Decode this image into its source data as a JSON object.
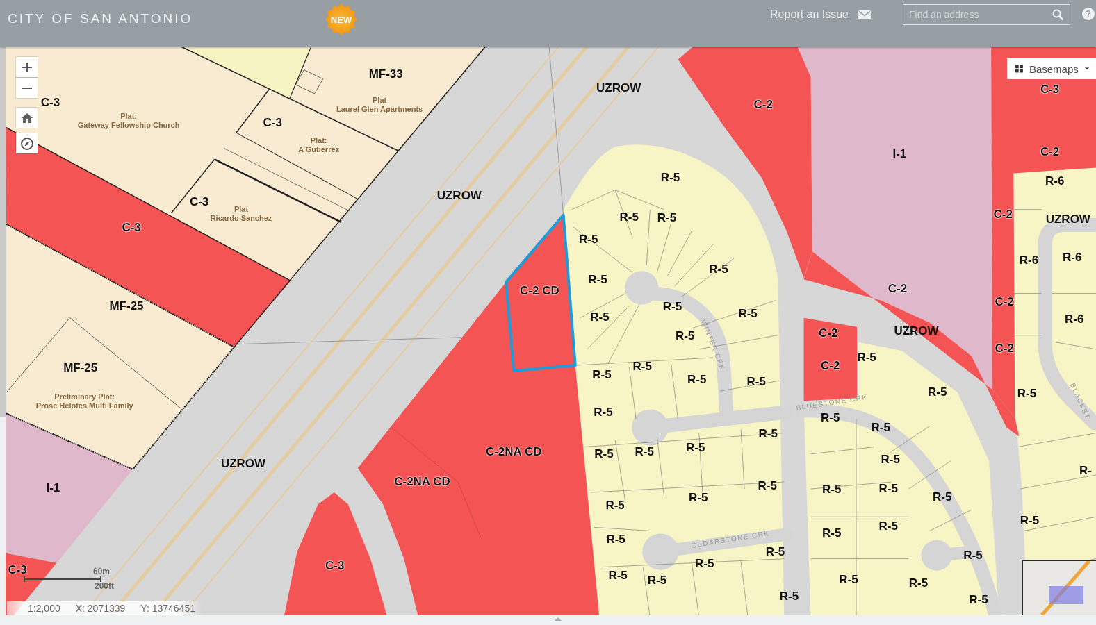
{
  "header": {
    "title": "CITY OF SAN ANTONIO",
    "badge": "NEW",
    "report_link": "Report an Issue",
    "search": {
      "placeholder": "Find an address"
    },
    "help": "?"
  },
  "map": {
    "basemaps_button": "Basemaps",
    "labels": [
      {
        "kind": "zone",
        "text": "MF-33"
      },
      {
        "kind": "zone",
        "text": "UZROW"
      },
      {
        "kind": "zone",
        "text": "C-3"
      },
      {
        "kind": "zone",
        "text": "C-3"
      },
      {
        "kind": "plat",
        "text": "Plat\nLaurel Glen Apartments"
      },
      {
        "kind": "zone",
        "text": "C-2"
      },
      {
        "kind": "plat",
        "text": "Plat:\nGateway Fellowship Church"
      },
      {
        "kind": "zone",
        "text": "C-3"
      },
      {
        "kind": "plat",
        "text": "Plat:\nA Gutierrez"
      },
      {
        "kind": "zone",
        "text": "I-1"
      },
      {
        "kind": "zone",
        "text": "C-2"
      },
      {
        "kind": "zone",
        "text": "R-5"
      },
      {
        "kind": "zone",
        "text": "R-6"
      },
      {
        "kind": "zone",
        "text": "UZROW"
      },
      {
        "kind": "zone",
        "text": "C-3"
      },
      {
        "kind": "plat",
        "text": "Plat\nRicardo Sanchez"
      },
      {
        "kind": "zone",
        "text": "R-5"
      },
      {
        "kind": "zone",
        "text": "R-5"
      },
      {
        "kind": "zone",
        "text": "C-2"
      },
      {
        "kind": "zone",
        "text": "UZROW"
      },
      {
        "kind": "zone",
        "text": "C-3"
      },
      {
        "kind": "zone",
        "text": "R-5"
      },
      {
        "kind": "zone",
        "text": "R-6"
      },
      {
        "kind": "zone",
        "text": "R-6"
      },
      {
        "kind": "zone",
        "text": "R-5"
      },
      {
        "kind": "zone",
        "text": "R-5"
      },
      {
        "kind": "zone",
        "text": "C-2 CD"
      },
      {
        "kind": "zone",
        "text": "C-2"
      },
      {
        "kind": "zone",
        "text": "MF-25"
      },
      {
        "kind": "zone",
        "text": "R-5"
      },
      {
        "kind": "zone",
        "text": "C-2"
      },
      {
        "kind": "zone",
        "text": "R-5"
      },
      {
        "kind": "zone",
        "text": "R-5"
      },
      {
        "kind": "zone",
        "text": "R-6"
      },
      {
        "kind": "zone",
        "text": "R-5"
      },
      {
        "kind": "zone",
        "text": "C-2"
      },
      {
        "kind": "zone",
        "text": "UZROW"
      },
      {
        "kind": "street",
        "text": "WINTER CRK"
      },
      {
        "kind": "zone",
        "text": "C-2"
      },
      {
        "kind": "zone",
        "text": "R-5"
      },
      {
        "kind": "zone",
        "text": "MF-25"
      },
      {
        "kind": "zone",
        "text": "R-5"
      },
      {
        "kind": "zone",
        "text": "C-2"
      },
      {
        "kind": "zone",
        "text": "R-5"
      },
      {
        "kind": "zone",
        "text": "R-5"
      },
      {
        "kind": "zone",
        "text": "R-5"
      },
      {
        "kind": "zone",
        "text": "R-5"
      },
      {
        "kind": "zone",
        "text": "R-5"
      },
      {
        "kind": "plat",
        "text": "Preliminary Plat:\nProse Helotes Multi Family"
      },
      {
        "kind": "street",
        "text": "BLUESTONE CRK"
      },
      {
        "kind": "street",
        "text": "BLACKST"
      },
      {
        "kind": "zone",
        "text": "R-5"
      },
      {
        "kind": "zone",
        "text": "R-5"
      },
      {
        "kind": "zone",
        "text": "R-5"
      },
      {
        "kind": "zone",
        "text": "R-5"
      },
      {
        "kind": "zone",
        "text": "C-2NA CD"
      },
      {
        "kind": "zone",
        "text": "R-5"
      },
      {
        "kind": "zone",
        "text": "R-5"
      },
      {
        "kind": "zone",
        "text": "R-5"
      },
      {
        "kind": "zone",
        "text": "UZROW"
      },
      {
        "kind": "zone",
        "text": "R-5"
      },
      {
        "kind": "zone",
        "text": "R-"
      },
      {
        "kind": "zone",
        "text": "I-1"
      },
      {
        "kind": "zone",
        "text": "C-2NA CD"
      },
      {
        "kind": "zone",
        "text": "R-5"
      },
      {
        "kind": "zone",
        "text": "R-5"
      },
      {
        "kind": "zone",
        "text": "R-5"
      },
      {
        "kind": "zone",
        "text": "R-5"
      },
      {
        "kind": "zone",
        "text": "R-5"
      },
      {
        "kind": "zone",
        "text": "R-5"
      },
      {
        "kind": "zone",
        "text": "R-5"
      },
      {
        "kind": "zone",
        "text": "R-5"
      },
      {
        "kind": "zone",
        "text": "R-5"
      },
      {
        "kind": "zone",
        "text": "R-5"
      },
      {
        "kind": "street",
        "text": "CEDARSTONE CRK"
      },
      {
        "kind": "zone",
        "text": "R-5"
      },
      {
        "kind": "zone",
        "text": "R-5"
      },
      {
        "kind": "zone",
        "text": "C-3"
      },
      {
        "kind": "zone",
        "text": "C-3"
      },
      {
        "kind": "zone",
        "text": "R-5"
      },
      {
        "kind": "zone",
        "text": "R-5"
      },
      {
        "kind": "zone",
        "text": "R-5"
      },
      {
        "kind": "zone",
        "text": "R-5"
      },
      {
        "kind": "zone",
        "text": "R-5"
      },
      {
        "kind": "zone",
        "text": "R-5"
      },
      {
        "kind": "zone",
        "text": "R-5"
      }
    ]
  },
  "scale_bar": {
    "metric": "60m",
    "imperial": "200ft"
  },
  "status_bar": {
    "scale": "1:2,000",
    "x": "X: 2071339",
    "y": "Y: 13746451"
  }
}
